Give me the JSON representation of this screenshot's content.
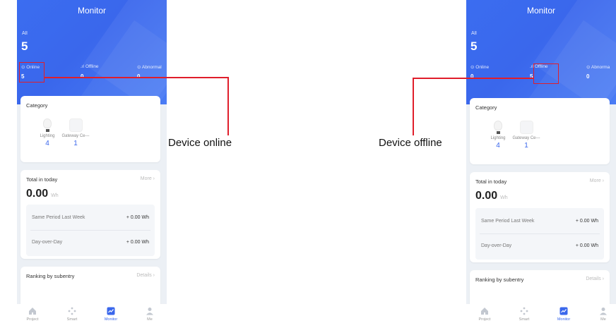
{
  "phones": [
    {
      "header": {
        "title": "Monitor",
        "all_label": "All",
        "all_count": "5",
        "online_label": "Online",
        "online_count": "5",
        "offline_label": "Offline",
        "offline_count": "0",
        "abnormal_label": "Abnormal",
        "abnormal_count": "0"
      },
      "category": {
        "title": "Category",
        "items": [
          {
            "name": "Lighting",
            "count": "4"
          },
          {
            "name": "Gateway Ce---",
            "count": "1"
          }
        ]
      },
      "total": {
        "title": "Total in today",
        "more": "More",
        "value": "0.00",
        "unit": "Wh",
        "rows": [
          {
            "label": "Same Period Last Week",
            "value": "+ 0.00 Wh"
          },
          {
            "label": "Day-over-Day",
            "value": "+ 0.00 Wh"
          }
        ]
      },
      "ranking": {
        "title": "Ranking by subentry",
        "link": "Details"
      }
    },
    {
      "header": {
        "title": "Monitor",
        "all_label": "All",
        "all_count": "5",
        "online_label": "Online",
        "online_count": "0",
        "offline_label": "Offline",
        "offline_count": "5",
        "abnormal_label": "Abnorma",
        "abnormal_count": "0"
      },
      "category": {
        "title": "Category",
        "items": [
          {
            "name": "Lighting",
            "count": "4"
          },
          {
            "name": "Gateway Ce---",
            "count": "1"
          }
        ]
      },
      "total": {
        "title": "Total in today",
        "more": "More",
        "value": "0.00",
        "unit": "Wh",
        "rows": [
          {
            "label": "Same Period Last Week",
            "value": "+ 0.00 Wh"
          },
          {
            "label": "Day-over-Day",
            "value": "+ 0.00 Wh"
          }
        ]
      },
      "ranking": {
        "title": "Ranking by subentry",
        "link": "Details"
      }
    }
  ],
  "tabs": [
    {
      "label": "Project",
      "icon": "home-icon"
    },
    {
      "label": "Smart",
      "icon": "smart-icon"
    },
    {
      "label": "Monitor",
      "icon": "monitor-icon",
      "active": true
    },
    {
      "label": "Me",
      "icon": "user-icon"
    }
  ],
  "annotations": {
    "online": "Device online",
    "offline": "Device offline"
  },
  "colors": {
    "accent": "#3a67ec",
    "highlight": "#e01e2b"
  }
}
